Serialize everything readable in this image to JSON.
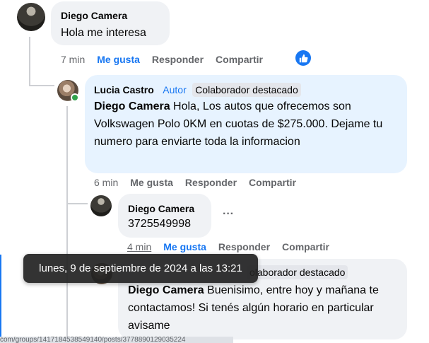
{
  "comments": [
    {
      "author": "Diego Camera",
      "text": "Hola me interesa",
      "time": "7 min",
      "like": "Me gusta",
      "reply": "Responder",
      "share": "Compartir"
    },
    {
      "author": "Lucia Castro",
      "role": "Autor",
      "badge": "Colaborador destacado",
      "mention": "Diego Camera",
      "text": " Hola, Los autos que ofrecemos son Volkswagen Polo 0KM en cuotas de $275.000. Dejame tu numero para enviarte toda la informacion",
      "time": "6 min",
      "like": "Me gusta",
      "reply": "Responder",
      "share": "Compartir"
    },
    {
      "author": "Diego Camera",
      "text": "3725549998",
      "more": "···",
      "time": "4 min",
      "like": "Me gusta",
      "reply": "Responder",
      "share": "Compartir"
    },
    {
      "badge": "olaborador destacado",
      "mention": "Diego Camera",
      "text": " Buenisimo, entre hoy y mañana te contactamos! Si tenés algún horario en particular avisame"
    }
  ],
  "tooltip": "lunes, 9 de septiembre de 2024 a las 13:21",
  "status_url": "com/groups/1417184538549140/posts/3778890129035224",
  "colors": {
    "accent": "#1877f2",
    "bubble": "#f0f2f5",
    "bubble_highlight": "#e7f3ff",
    "online": "#31a24c"
  },
  "icons": [
    "like-reaction-icon",
    "more-options-icon",
    "online-status-icon"
  ]
}
